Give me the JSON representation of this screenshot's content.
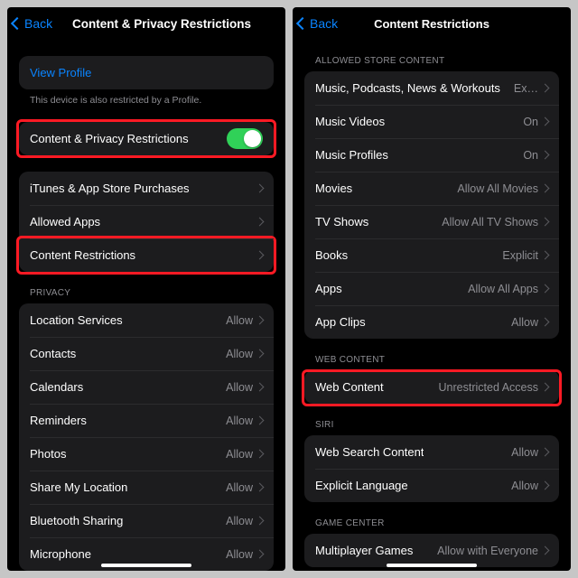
{
  "left": {
    "back": "Back",
    "title": "Content & Privacy Restrictions",
    "profile": {
      "view": "View Profile",
      "note": "This device is also restricted by a Profile."
    },
    "main_toggle": {
      "label": "Content & Privacy Restrictions",
      "on": true
    },
    "r1": {
      "label": "iTunes & App Store Purchases"
    },
    "r2": {
      "label": "Allowed Apps"
    },
    "r3": {
      "label": "Content Restrictions"
    },
    "privacy_header": "PRIVACY",
    "p": [
      {
        "label": "Location Services",
        "value": "Allow"
      },
      {
        "label": "Contacts",
        "value": "Allow"
      },
      {
        "label": "Calendars",
        "value": "Allow"
      },
      {
        "label": "Reminders",
        "value": "Allow"
      },
      {
        "label": "Photos",
        "value": "Allow"
      },
      {
        "label": "Share My Location",
        "value": "Allow"
      },
      {
        "label": "Bluetooth Sharing",
        "value": "Allow"
      },
      {
        "label": "Microphone",
        "value": "Allow"
      }
    ]
  },
  "right": {
    "back": "Back",
    "title": "Content Restrictions",
    "store_header": "ALLOWED STORE CONTENT",
    "s": [
      {
        "label": "Music, Podcasts, News & Workouts",
        "value": "Ex…"
      },
      {
        "label": "Music Videos",
        "value": "On"
      },
      {
        "label": "Music Profiles",
        "value": "On"
      },
      {
        "label": "Movies",
        "value": "Allow All Movies"
      },
      {
        "label": "TV Shows",
        "value": "Allow All TV Shows"
      },
      {
        "label": "Books",
        "value": "Explicit"
      },
      {
        "label": "Apps",
        "value": "Allow All Apps"
      },
      {
        "label": "App Clips",
        "value": "Allow"
      }
    ],
    "web_header": "WEB CONTENT",
    "web": {
      "label": "Web Content",
      "value": "Unrestricted Access"
    },
    "siri_header": "SIRI",
    "siri": [
      {
        "label": "Web Search Content",
        "value": "Allow"
      },
      {
        "label": "Explicit Language",
        "value": "Allow"
      }
    ],
    "gc_header": "GAME CENTER",
    "gc": [
      {
        "label": "Multiplayer Games",
        "value": "Allow with Everyone"
      }
    ]
  }
}
